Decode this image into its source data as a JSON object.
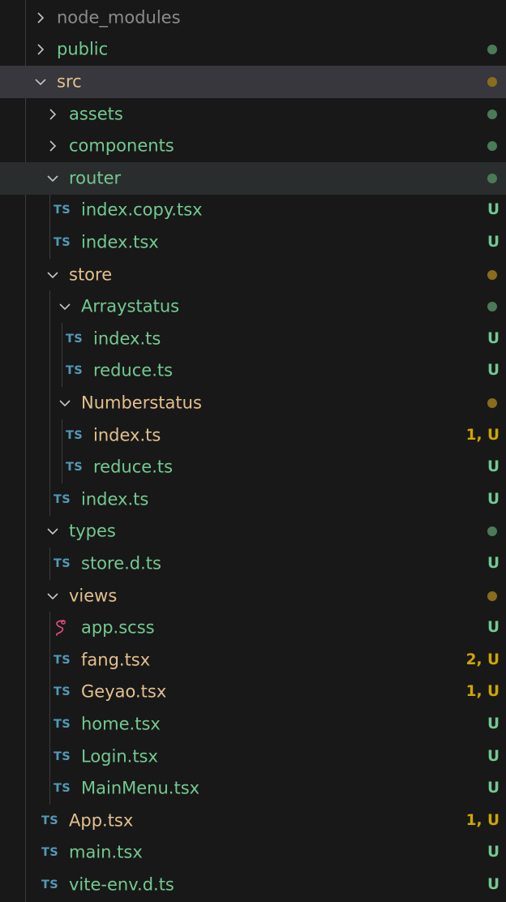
{
  "tree": [
    {
      "kind": "folder",
      "label": "node_modules",
      "depth": 0,
      "expanded": false,
      "color": "grey",
      "status": "",
      "dot": ""
    },
    {
      "kind": "folder",
      "label": "public",
      "depth": 0,
      "expanded": false,
      "color": "green",
      "status": "",
      "dot": "g"
    },
    {
      "kind": "folder",
      "label": "src",
      "depth": 0,
      "expanded": true,
      "color": "gold",
      "status": "",
      "dot": "o",
      "highlight": "sel"
    },
    {
      "kind": "folder",
      "label": "assets",
      "depth": 1,
      "expanded": false,
      "color": "green",
      "status": "",
      "dot": "g"
    },
    {
      "kind": "folder",
      "label": "components",
      "depth": 1,
      "expanded": false,
      "color": "green",
      "status": "",
      "dot": "g"
    },
    {
      "kind": "folder",
      "label": "router",
      "depth": 1,
      "expanded": true,
      "color": "green",
      "status": "",
      "dot": "g",
      "highlight": "hl"
    },
    {
      "kind": "file",
      "icon": "ts",
      "label": "index.copy.tsx",
      "depth": 2,
      "color": "green",
      "status": "U",
      "statusColor": "g"
    },
    {
      "kind": "file",
      "icon": "ts",
      "label": "index.tsx",
      "depth": 2,
      "color": "green",
      "status": "U",
      "statusColor": "g"
    },
    {
      "kind": "folder",
      "label": "store",
      "depth": 1,
      "expanded": true,
      "color": "gold",
      "status": "",
      "dot": "o"
    },
    {
      "kind": "folder",
      "label": "Arraystatus",
      "depth": 2,
      "expanded": true,
      "color": "green",
      "status": "",
      "dot": "g"
    },
    {
      "kind": "file",
      "icon": "ts",
      "label": "index.ts",
      "depth": 3,
      "color": "green",
      "status": "U",
      "statusColor": "g"
    },
    {
      "kind": "file",
      "icon": "ts",
      "label": "reduce.ts",
      "depth": 3,
      "color": "green",
      "status": "U",
      "statusColor": "g"
    },
    {
      "kind": "folder",
      "label": "Numberstatus",
      "depth": 2,
      "expanded": true,
      "color": "gold",
      "status": "",
      "dot": "o"
    },
    {
      "kind": "file",
      "icon": "ts",
      "label": "index.ts",
      "depth": 3,
      "color": "gold",
      "status": "1, U",
      "statusColor": "o"
    },
    {
      "kind": "file",
      "icon": "ts",
      "label": "reduce.ts",
      "depth": 3,
      "color": "green",
      "status": "U",
      "statusColor": "g"
    },
    {
      "kind": "file",
      "icon": "ts",
      "label": "index.ts",
      "depth": 2,
      "color": "green",
      "status": "U",
      "statusColor": "g"
    },
    {
      "kind": "folder",
      "label": "types",
      "depth": 1,
      "expanded": true,
      "color": "green",
      "status": "",
      "dot": "g"
    },
    {
      "kind": "file",
      "icon": "ts",
      "label": "store.d.ts",
      "depth": 2,
      "color": "green",
      "status": "U",
      "statusColor": "g"
    },
    {
      "kind": "folder",
      "label": "views",
      "depth": 1,
      "expanded": true,
      "color": "gold",
      "status": "",
      "dot": "o"
    },
    {
      "kind": "file",
      "icon": "scss",
      "label": "app.scss",
      "depth": 2,
      "color": "green",
      "status": "U",
      "statusColor": "g"
    },
    {
      "kind": "file",
      "icon": "ts",
      "label": "fang.tsx",
      "depth": 2,
      "color": "gold",
      "status": "2, U",
      "statusColor": "o"
    },
    {
      "kind": "file",
      "icon": "ts",
      "label": "Geyao.tsx",
      "depth": 2,
      "color": "gold",
      "status": "1, U",
      "statusColor": "o"
    },
    {
      "kind": "file",
      "icon": "ts",
      "label": "home.tsx",
      "depth": 2,
      "color": "green",
      "status": "U",
      "statusColor": "g"
    },
    {
      "kind": "file",
      "icon": "ts",
      "label": "Login.tsx",
      "depth": 2,
      "color": "green",
      "status": "U",
      "statusColor": "g"
    },
    {
      "kind": "file",
      "icon": "ts",
      "label": "MainMenu.tsx",
      "depth": 2,
      "color": "green",
      "status": "U",
      "statusColor": "g"
    },
    {
      "kind": "file",
      "icon": "ts",
      "label": "App.tsx",
      "depth": 1,
      "color": "gold",
      "status": "1, U",
      "statusColor": "o"
    },
    {
      "kind": "file",
      "icon": "ts",
      "label": "main.tsx",
      "depth": 1,
      "color": "green",
      "status": "U",
      "statusColor": "g"
    },
    {
      "kind": "file",
      "icon": "ts",
      "label": "vite-env.d.ts",
      "depth": 1,
      "color": "green",
      "status": "U",
      "statusColor": "g"
    }
  ],
  "ts_icon_text": "TS"
}
